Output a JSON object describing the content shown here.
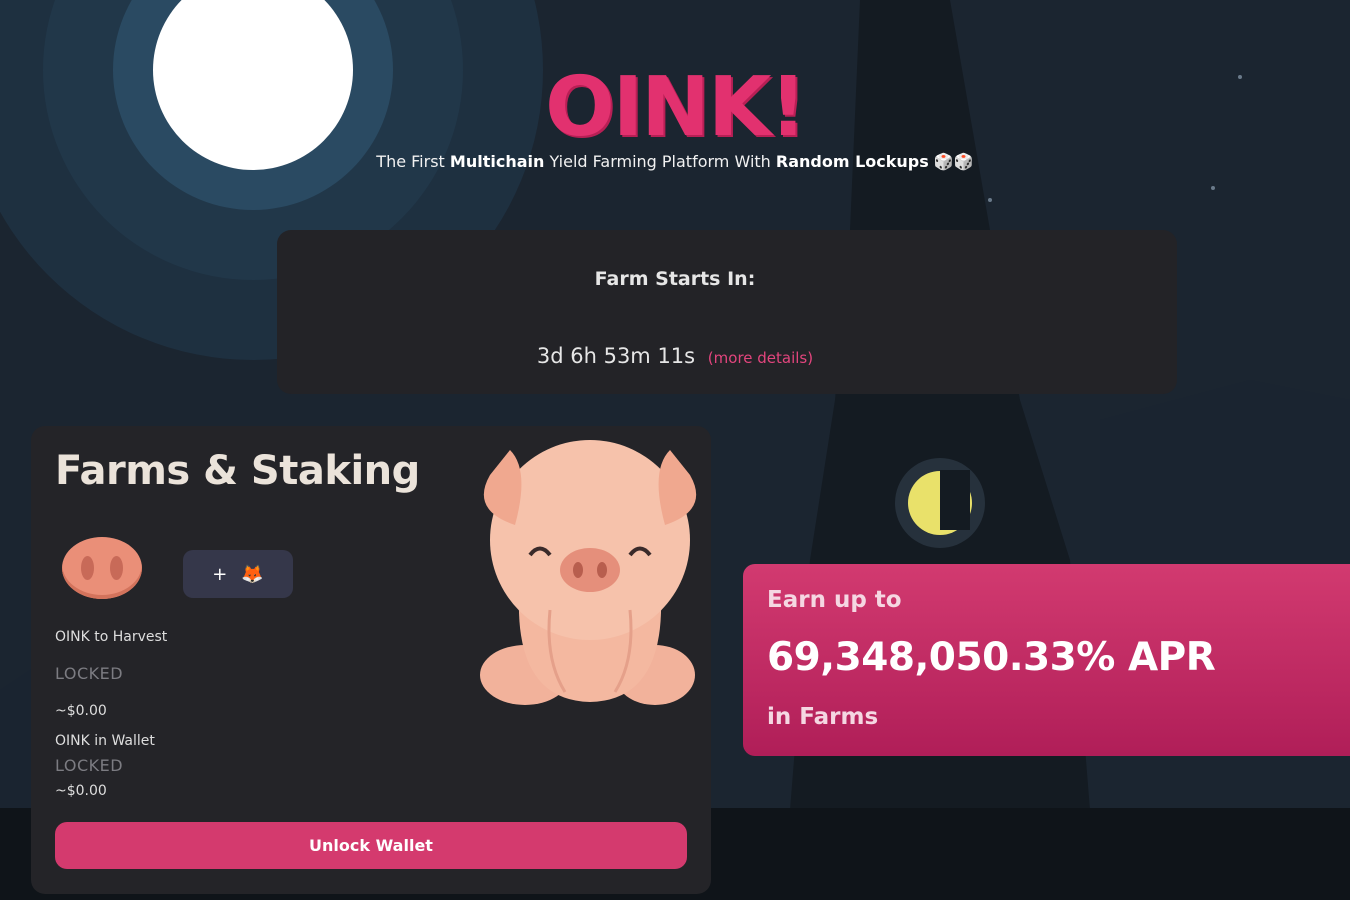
{
  "brand": {
    "logo": "OINK!",
    "tagline_parts": [
      "The First ",
      "Multichain",
      " Yield Farming Platform With ",
      "Random Lockups",
      " 🎲🎲"
    ]
  },
  "countdown": {
    "title": "Farm Starts In:",
    "time": "3d 6h 53m 11s",
    "link_label": "(more details)"
  },
  "farms": {
    "title": "Farms & Staking",
    "add_token_icons": [
      "plus-icon",
      "metamask-fox-icon"
    ],
    "add_token_plus": "+",
    "add_token_fox": "🦊",
    "harvest_label": "OINK to Harvest",
    "harvest_value": "LOCKED",
    "harvest_usd": "~$0.00",
    "wallet_label": "OINK in Wallet",
    "wallet_value": "LOCKED",
    "wallet_usd": "~$0.00",
    "unlock_button": "Unlock Wallet"
  },
  "apr": {
    "earn_label": "Earn up to",
    "value": "69,348,050.33% APR",
    "suffix": "in Farms"
  },
  "colors": {
    "accent": "#d43a6e",
    "background": "#1b2530",
    "card": "#242428"
  }
}
